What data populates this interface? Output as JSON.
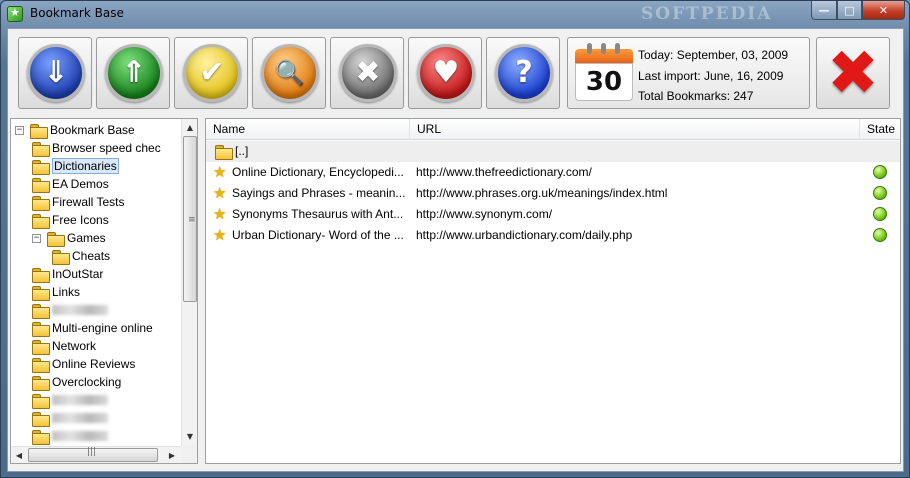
{
  "window": {
    "title": "Bookmark Base",
    "watermark": "SOFTPEDIA",
    "controls": {
      "minimize": "—",
      "maximize": "□",
      "close": "✕"
    }
  },
  "toolbar": {
    "buttons": [
      {
        "id": "import",
        "icon": "download-arrow-icon",
        "glyph": "⇓",
        "color": "#1e3fb0"
      },
      {
        "id": "export",
        "icon": "upload-arrow-icon",
        "glyph": "⇑",
        "color": "#17801a"
      },
      {
        "id": "check",
        "icon": "checkmark-icon",
        "glyph": "✔",
        "color": "#e2c21a"
      },
      {
        "id": "search",
        "icon": "magnifier-icon",
        "glyph": "🔍",
        "color": "#e07a10"
      },
      {
        "id": "tools",
        "icon": "tools-icon",
        "glyph": "✖",
        "color": "#6a6a6a"
      },
      {
        "id": "favorites",
        "icon": "heart-icon",
        "glyph": "♥",
        "color": "#c01818"
      },
      {
        "id": "help",
        "icon": "question-icon",
        "glyph": "?",
        "color": "#1a3fd0"
      }
    ],
    "info": {
      "calendar_day": "30",
      "today": "Today: September, 03, 2009",
      "last_import": "Last import: June, 16, 2009",
      "total": "Total Bookmarks: 247"
    },
    "exit_glyph": "✖"
  },
  "tree": {
    "items": [
      {
        "label": "Bookmark Base",
        "level": 0,
        "expander": "−"
      },
      {
        "label": "Browser speed chec",
        "level": 1
      },
      {
        "label": "Dictionaries",
        "level": 1,
        "selected": true
      },
      {
        "label": "EA Demos",
        "level": 1
      },
      {
        "label": "Firewall Tests",
        "level": 1
      },
      {
        "label": "Free Icons",
        "level": 1
      },
      {
        "label": "Games",
        "level": 1,
        "expander": "−"
      },
      {
        "label": "Cheats",
        "level": 2
      },
      {
        "label": "InOutStar",
        "level": 1
      },
      {
        "label": "Links",
        "level": 1
      },
      {
        "label": "",
        "level": 1,
        "blurred": true
      },
      {
        "label": "Multi-engine online",
        "level": 1
      },
      {
        "label": "Network",
        "level": 1
      },
      {
        "label": "Online Reviews",
        "level": 1
      },
      {
        "label": "Overclocking",
        "level": 1
      },
      {
        "label": "",
        "level": 1,
        "blurred": true
      },
      {
        "label": "",
        "level": 1,
        "blurred": true
      },
      {
        "label": "",
        "level": 1,
        "blurred": true
      }
    ],
    "scroll_up": "▲",
    "scroll_down": "▼",
    "scroll_left": "◀",
    "scroll_right": "▶",
    "vgrip": "≡",
    "hgrip": "|||"
  },
  "list": {
    "columns": {
      "name": "Name",
      "url": "URL",
      "state": "State"
    },
    "up_label": "[..]",
    "rows": [
      {
        "name": "Online Dictionary, Encyclopedi...",
        "url": "http://www.thefreedictionary.com/",
        "state": "ok"
      },
      {
        "name": "Sayings and Phrases - meanin...",
        "url": "http://www.phrases.org.uk/meanings/index.html",
        "state": "ok"
      },
      {
        "name": "Synonyms Thesaurus with Ant...",
        "url": "http://www.synonym.com/",
        "state": "ok"
      },
      {
        "name": "Urban Dictionary- Word of the ...",
        "url": "http://www.urbandictionary.com/daily.php",
        "state": "ok"
      }
    ]
  }
}
